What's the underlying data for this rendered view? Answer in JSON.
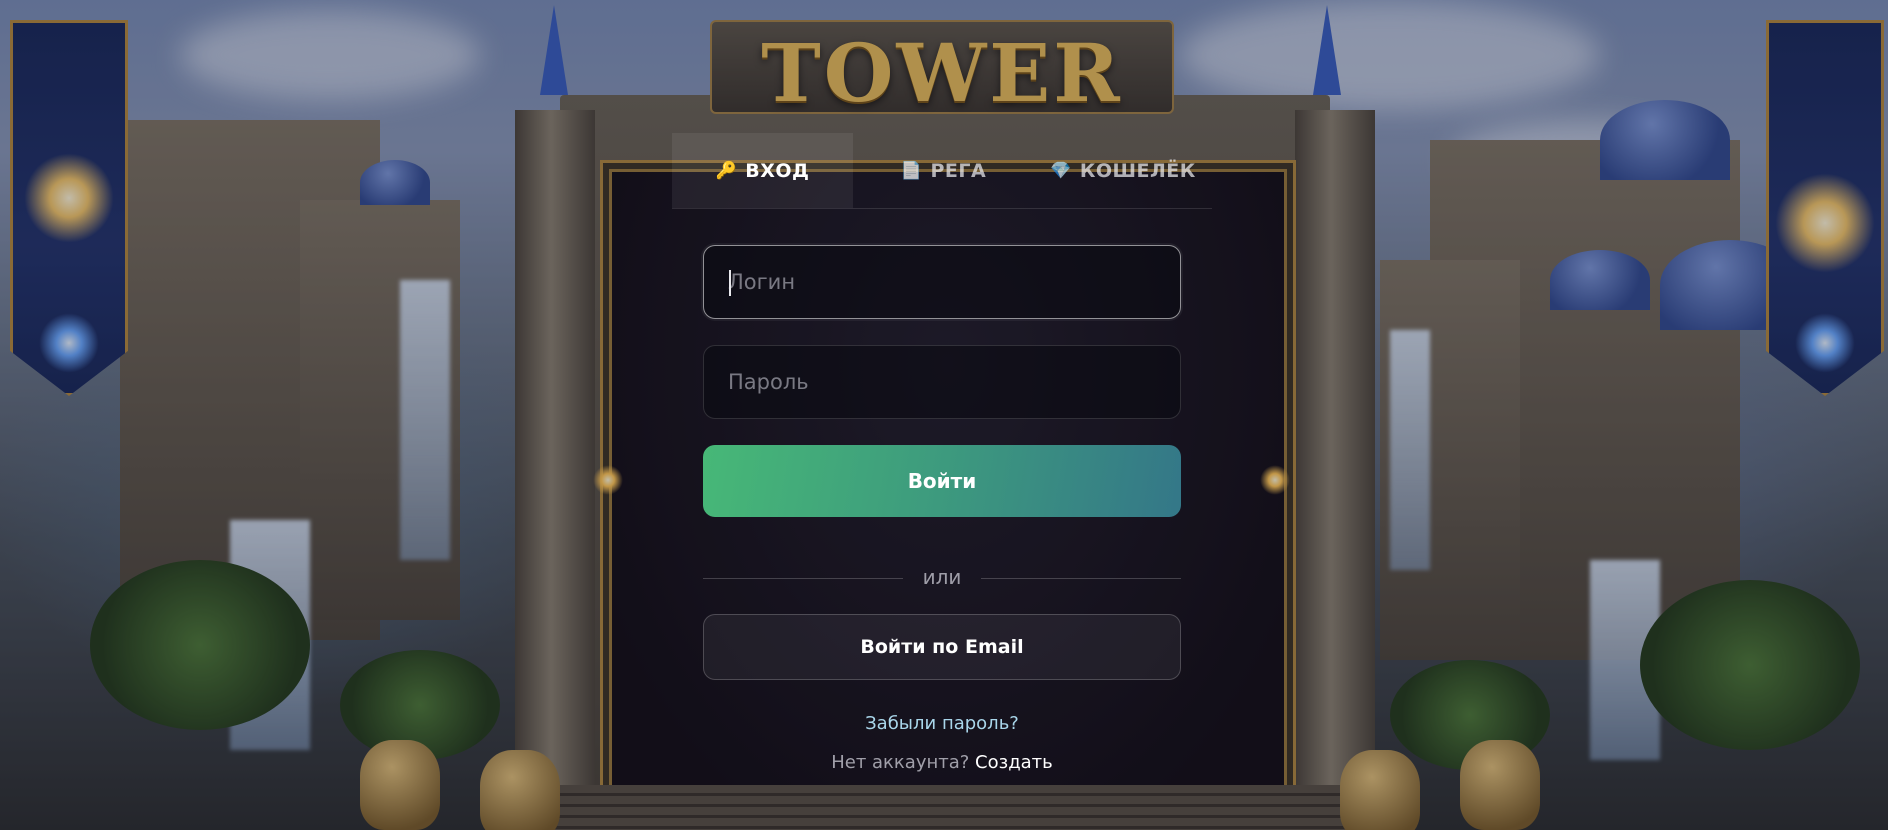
{
  "logo": {
    "title": "TOWER"
  },
  "tabs": [
    {
      "label": "ВХОД",
      "icon": "key-icon",
      "glyph": "🔑",
      "active": true
    },
    {
      "label": "РЕГА",
      "icon": "scroll-icon",
      "glyph": "📄",
      "active": false
    },
    {
      "label": "КОШЕЛЁК",
      "icon": "diamond-icon",
      "glyph": "💎",
      "active": false
    }
  ],
  "form": {
    "login_placeholder": "Логин",
    "password_placeholder": "Пароль",
    "submit_label": "Войти",
    "divider_text": "или",
    "email_login_label": "Войти по Email",
    "forgot_password": "Забыли пароль?",
    "no_account_text": "Нет аккаунта?",
    "create_link": "Создать"
  },
  "colors": {
    "primary_gradient_start": "#47b877",
    "primary_gradient_end": "#347788",
    "title_gold": "#e7bd5d",
    "link_blue": "#a9d6ea"
  }
}
